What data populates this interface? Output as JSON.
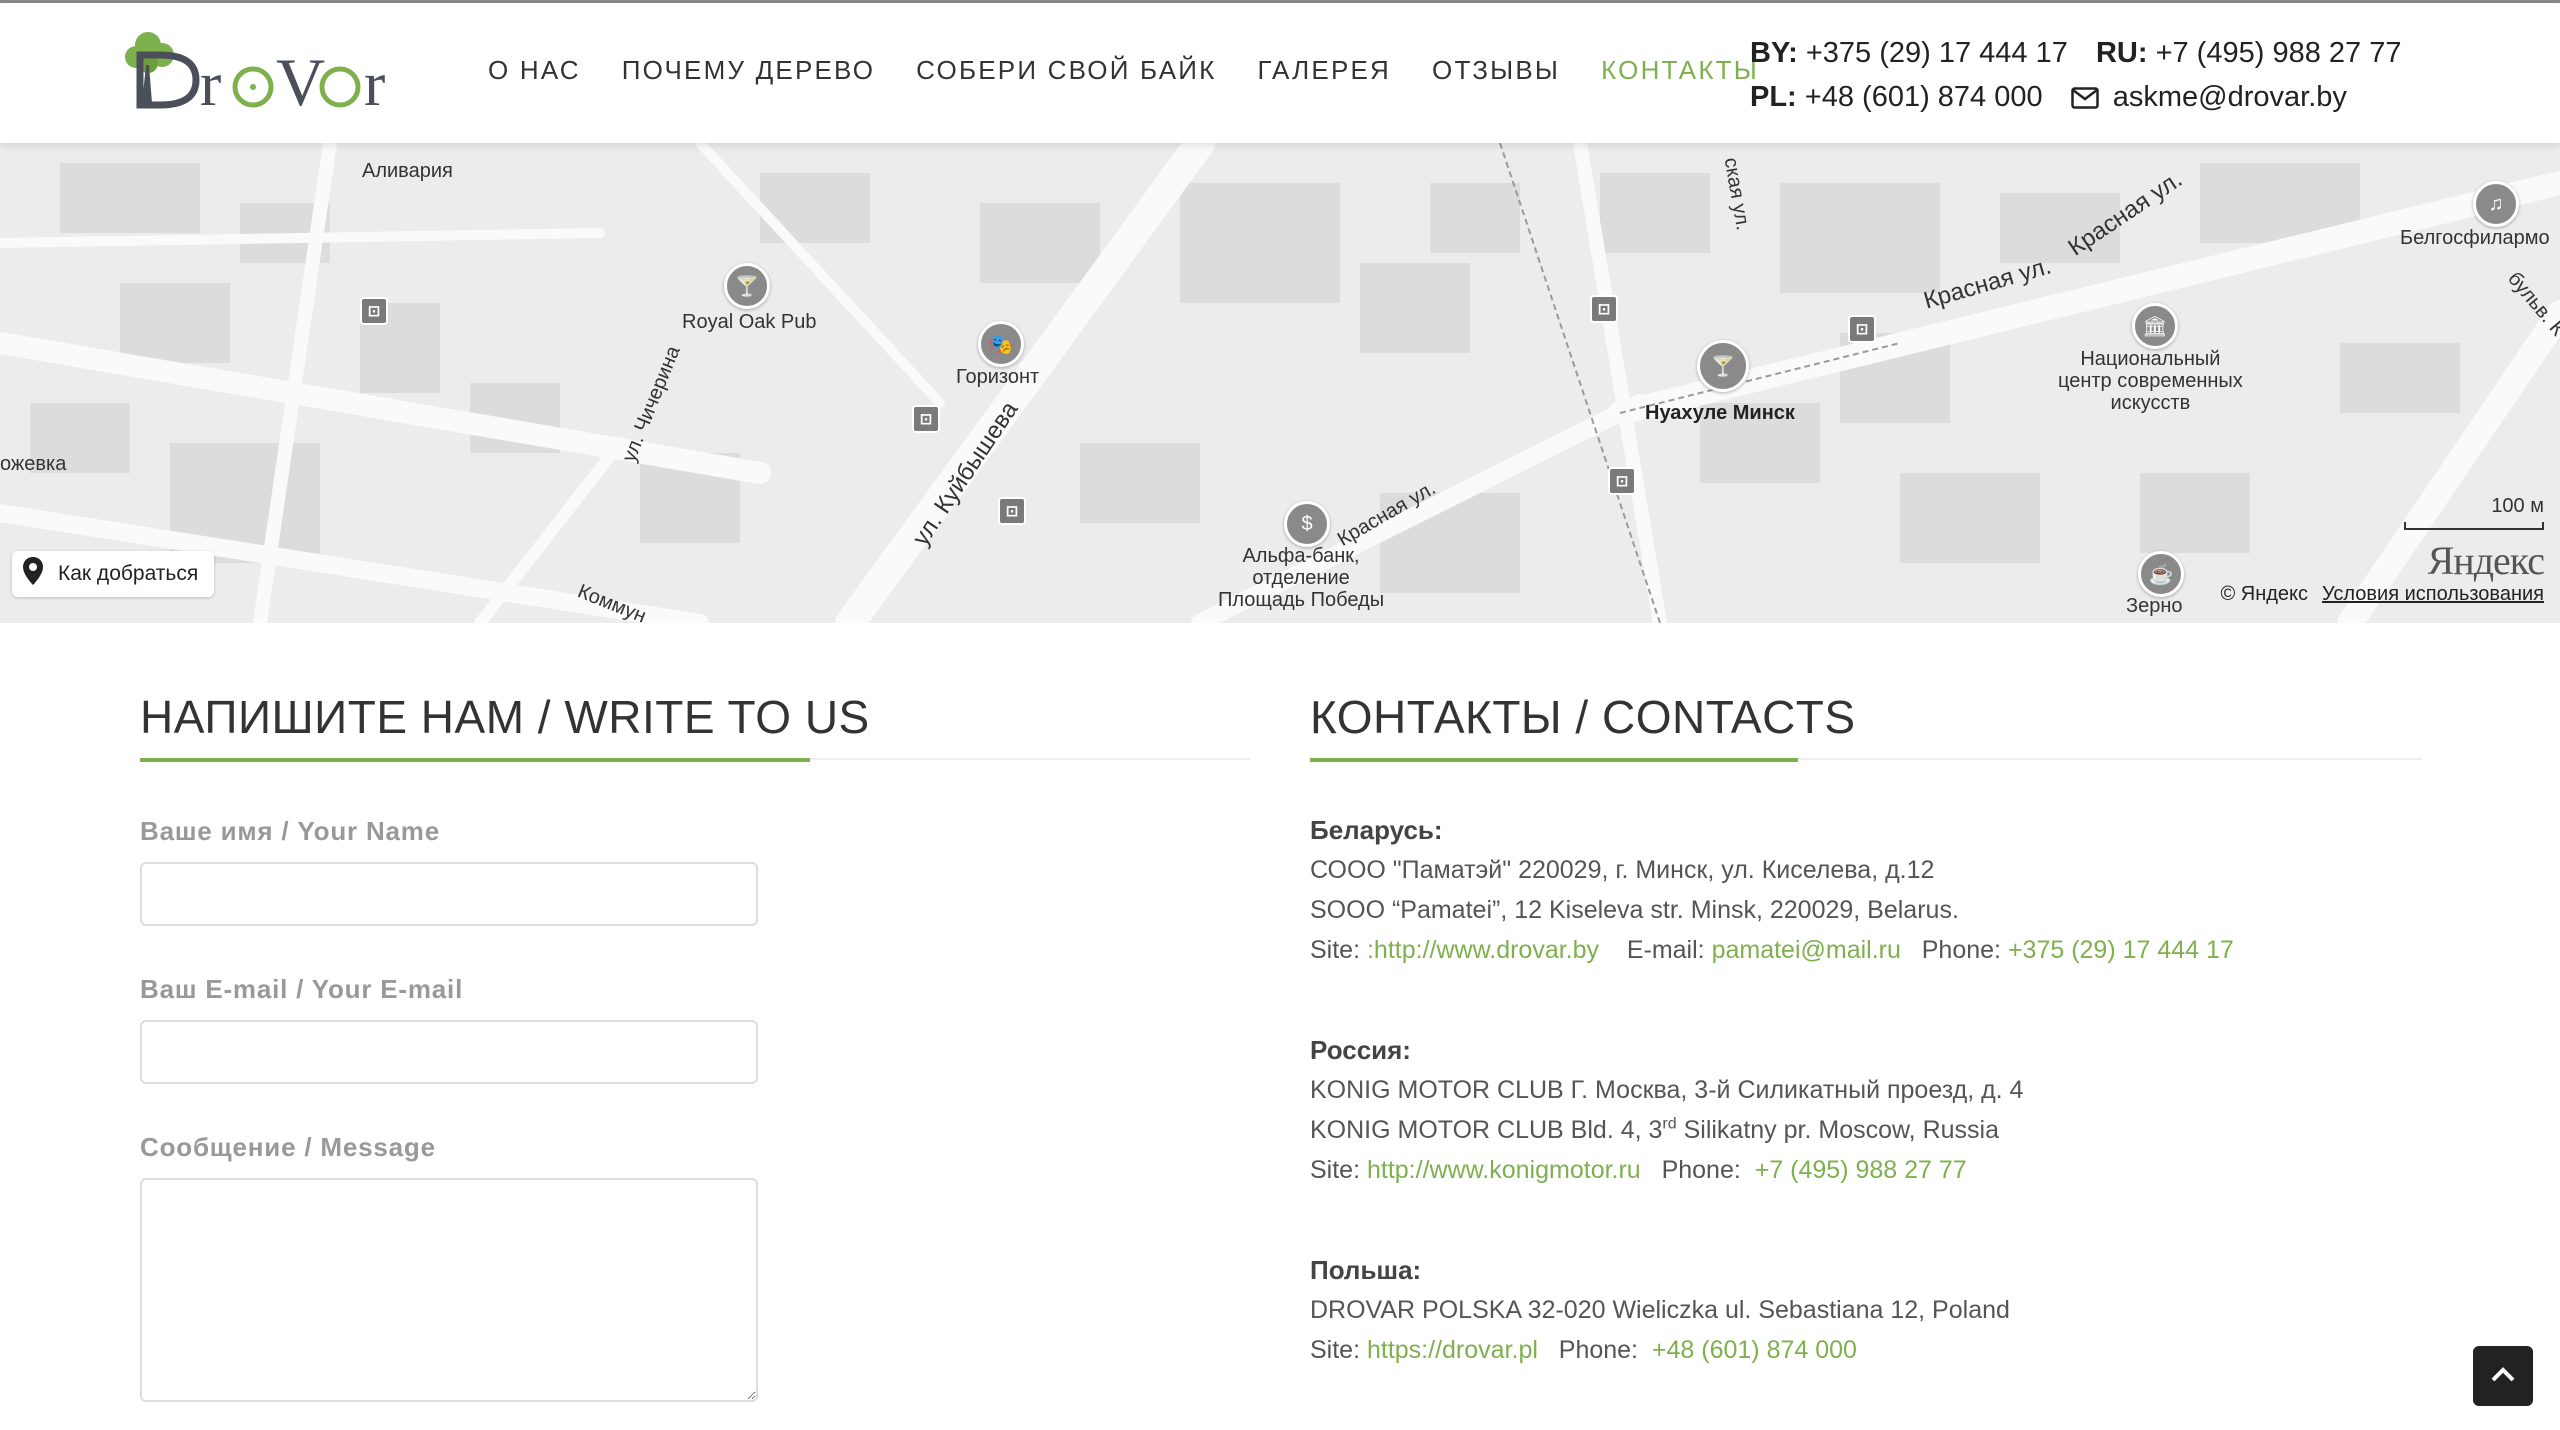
{
  "brand": {
    "logo_text": "DrOVar"
  },
  "nav": {
    "items": [
      {
        "label": "О НАС",
        "active": false
      },
      {
        "label": "ПОЧЕМУ ДЕРЕВО",
        "active": false
      },
      {
        "label": "СОБЕРИ СВОЙ БАЙК",
        "active": false
      },
      {
        "label": "ГАЛЕРЕЯ",
        "active": false
      },
      {
        "label": "ОТЗЫВЫ",
        "active": false
      },
      {
        "label": "КОНТАКТЫ",
        "active": true
      }
    ]
  },
  "header_contacts": {
    "by_label": "BY:",
    "by_phone": "+375 (29) 17 444 17",
    "ru_label": "RU:",
    "ru_phone": "+7 (495) 988 27 77",
    "pl_label": "PL:",
    "pl_phone": "+48 (601) 874 000",
    "email": "askme@drovar.by"
  },
  "map": {
    "labels": {
      "alivaria": "Аливария",
      "royal_oak": "Royal Oak Pub",
      "gorizont": "Горизонт",
      "nuahule": "Нуахуле Минск",
      "natsionalny": "Национальный\nцентр современных\nискусств",
      "belgosfil": "Белгосфилармо",
      "alfa": "Альфа-банк,\nотделение\nПлощадь Победы",
      "zerno": "Зерно",
      "kuibysheva": "ул. Куйбышева",
      "chicherina": "ул. Чичерина",
      "krasnaya1": "Красная ул.",
      "krasnaya2": "Красная ул.",
      "krasnaya3": "Красная ул.",
      "zhevka": "ожевка",
      "kommun": "Коммун",
      "bulv": "бульв. К",
      "skaya": "ская ул."
    },
    "route_label": "Как добраться",
    "scale_label": "100 м",
    "yandex_logo": "Яндекс",
    "copyright": "© Яндекс",
    "terms": "Условия использования"
  },
  "form": {
    "heading": "НАПИШИТЕ НАМ / WRITE TO US",
    "name_label": "Ваше имя / Your Name",
    "email_label": "Ваш E-mail / Your E-mail",
    "message_label": "Сообщение / Message"
  },
  "contacts": {
    "heading": "КОНТАКТЫ / CONTACTS",
    "belarus": {
      "country": "Беларусь:",
      "line1": "СООО \"Паматэй\" 220029, г. Минск, ул. Киселева, д.12",
      "line2": "SOOO “Pamatei”, 12 Kiseleva str. Minsk, 220029, Belarus.",
      "site_label": "Site: ",
      "site": ":http://www.drovar.by",
      "email_label": "E-mail: ",
      "email": "pamatei@mail.ru",
      "phone_label": "Phone: ",
      "phone": "+375 (29) 17 444 17"
    },
    "russia": {
      "country": "Россия:",
      "line1": "KONIG MOTOR CLUB  Г. Москва, 3-й Силикатный проезд, д. 4",
      "line2_pre": "KONIG MOTOR CLUB  Bld. 4, 3",
      "line2_sup": "rd",
      "line2_post": " Silikatny pr. Moscow, Russia",
      "site_label": "Site: ",
      "site": "http://www.konigmotor.ru",
      "phone_label": "Phone: ",
      "phone": "+7 (495) 988 27 77"
    },
    "poland": {
      "country": "Польша:",
      "line1": "DROVAR POLSKA  32-020 Wieliczka  ul. Sebastiana 12, Poland",
      "site_label": "Site: ",
      "site": "https://drovar.pl",
      "phone_label": "Phone: ",
      "phone": "+48 (601) 874 000"
    }
  },
  "colors": {
    "accent": "#7fb04e",
    "text": "#555555",
    "map_bg": "#ededed"
  }
}
